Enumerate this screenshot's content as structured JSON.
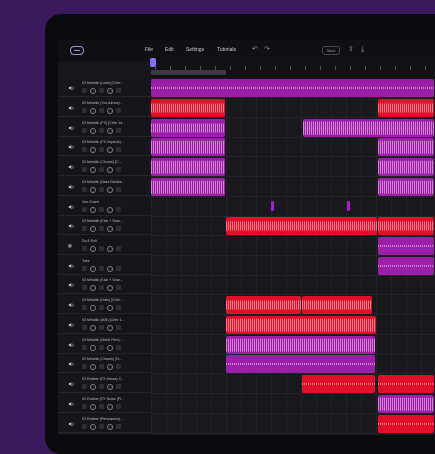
{
  "menu": {
    "items": [
      "File",
      "Edit",
      "Settings",
      "Tutorials"
    ],
    "save_label": "Save"
  },
  "tracks": [
    {
      "name": "03 Metallic (Lead) [Crthr..."
    },
    {
      "name": "03 Metallic (Vox Atmos)..."
    },
    {
      "name": "03 Metallic (FX) [Crthr 14..."
    },
    {
      "name": "03 Metallic (FX Impacts)..."
    },
    {
      "name": "03 Metallic (Chords) [C..."
    },
    {
      "name": "03 Metallic (Bass Breaks..."
    },
    {
      "name": "Vox Chant"
    },
    {
      "name": "03 Metallic (Kick + Snar..."
    },
    {
      "name": "Do A Roll"
    },
    {
      "name": "Toks"
    },
    {
      "name": "03 Metallic (Kick + Snar..."
    },
    {
      "name": "03 Metallic (Hats) [Crthr..."
    },
    {
      "name": "03 Metallic (808) [Crthr 1..."
    },
    {
      "name": "03 Metallic (Metal Perc)..."
    },
    {
      "name": "03 Metallic (Chants) [Cr..."
    },
    {
      "name": "03 Rubber (FX Atmos) C..."
    },
    {
      "name": "03 Rubber (FX Noise (Pl..."
    },
    {
      "name": "03 Rubber (Percussion)..."
    }
  ],
  "icons": {
    "logo": "wave-logo-icon",
    "undo": "undo-icon",
    "redo": "redo-icon",
    "share": "share-icon",
    "download": "download-icon",
    "speaker": "speaker-icon",
    "midi": "midi-icon"
  },
  "colors": {
    "purple_clip": "#9c1fa8",
    "red_clip": "#e0102a",
    "playhead": "#8a6ff0",
    "background": "#3a1a5c"
  }
}
